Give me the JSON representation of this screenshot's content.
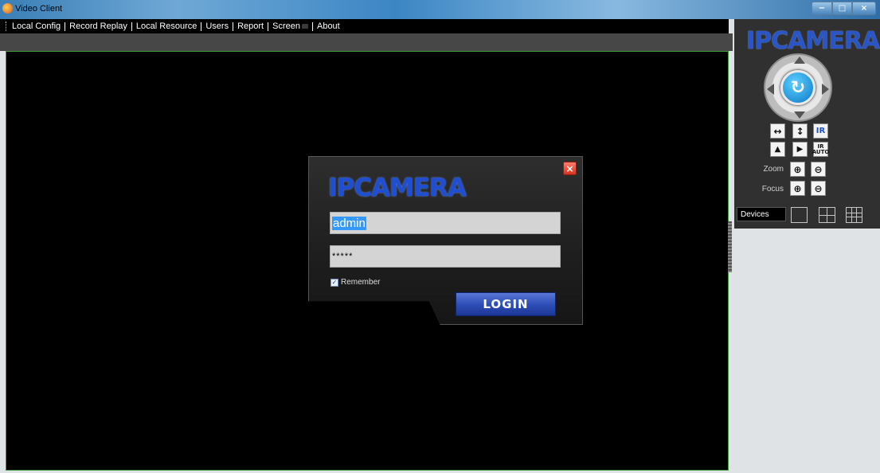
{
  "window": {
    "title": "Video Client",
    "min_label": "−",
    "max_label": "□",
    "close_label": "×"
  },
  "menu": {
    "items": [
      "Local Config",
      "Record Replay",
      "Local Resource",
      "Users",
      "Report",
      "Screen",
      "About"
    ]
  },
  "panel": {
    "logo": "IPCAMERA",
    "ptz_center_glyph": "↻",
    "zoom_label": "Zoom",
    "focus_label": "Focus",
    "ir_label": "IR",
    "ir_auto_top": "IR",
    "ir_auto_bottom": "AUTO",
    "devices_label": "Devices",
    "zoom_in_glyph": "⊕",
    "zoom_out_glyph": "⊖",
    "flip_h_glyph": "↔",
    "flip_v_glyph": "↕",
    "mirror_glyph": "▲",
    "play_glyph": "▶"
  },
  "login": {
    "logo": "IPCAMERA",
    "username": "admin",
    "password_mask": "*****",
    "remember_label": "Remember",
    "remember_checked": true,
    "check_glyph": "✓",
    "login_label": "LOGIN",
    "close_glyph": "×"
  },
  "colors": {
    "accent": "#1f4fd0",
    "video_border": "#3c9a3c",
    "close_red": "#d8321e"
  }
}
